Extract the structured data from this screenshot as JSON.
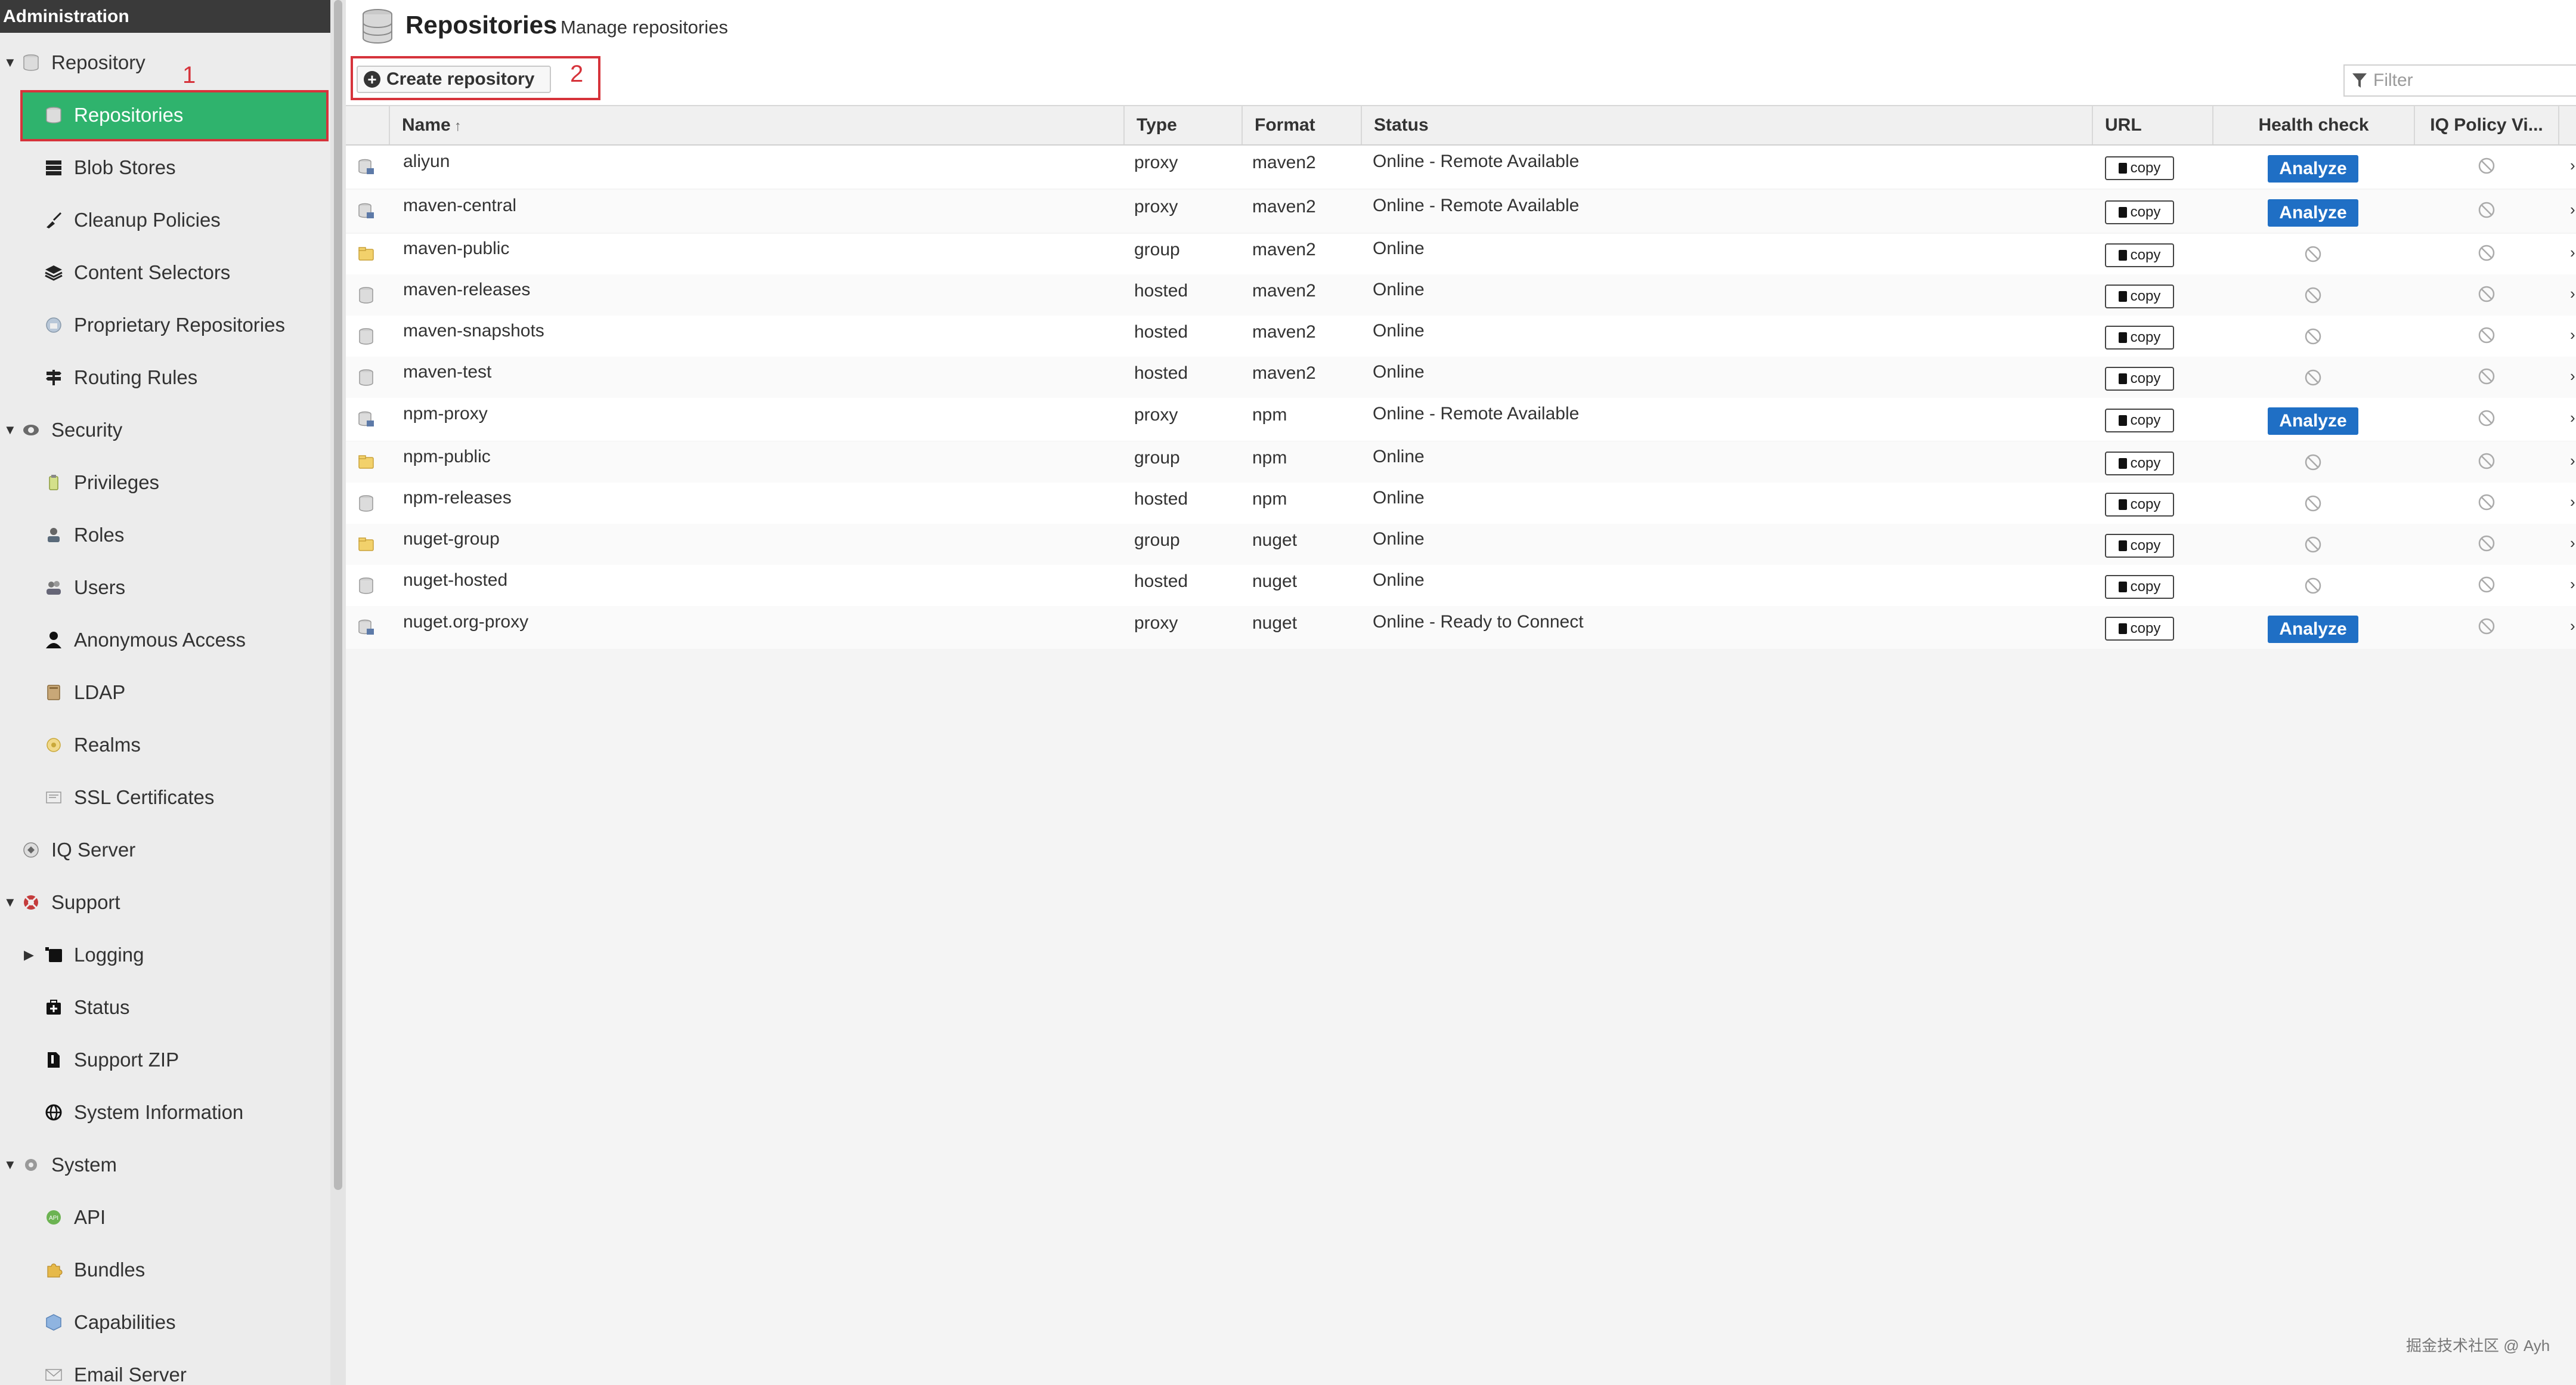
{
  "sidebar": {
    "header": "Administration",
    "items": [
      {
        "label": "Repository",
        "level": 0,
        "expanded": true,
        "icon": "database-icon"
      },
      {
        "label": "Repositories",
        "level": 1,
        "selected": true,
        "icon": "database-icon"
      },
      {
        "label": "Blob Stores",
        "level": 1,
        "icon": "server-icon"
      },
      {
        "label": "Cleanup Policies",
        "level": 1,
        "icon": "broom-icon"
      },
      {
        "label": "Content Selectors",
        "level": 1,
        "icon": "layers-icon"
      },
      {
        "label": "Proprietary Repositories",
        "level": 1,
        "icon": "proprietary-icon"
      },
      {
        "label": "Routing Rules",
        "level": 1,
        "icon": "signpost-icon"
      },
      {
        "label": "Security",
        "level": 0,
        "expanded": true,
        "icon": "security-icon"
      },
      {
        "label": "Privileges",
        "level": 1,
        "icon": "privileges-icon"
      },
      {
        "label": "Roles",
        "level": 1,
        "icon": "role-icon"
      },
      {
        "label": "Users",
        "level": 1,
        "icon": "users-icon"
      },
      {
        "label": "Anonymous Access",
        "level": 1,
        "icon": "user-icon"
      },
      {
        "label": "LDAP",
        "level": 1,
        "icon": "ldap-book-icon"
      },
      {
        "label": "Realms",
        "level": 1,
        "icon": "realm-icon"
      },
      {
        "label": "SSL Certificates",
        "level": 1,
        "icon": "certificate-icon"
      },
      {
        "label": "IQ Server",
        "level": 0,
        "icon": "iq-server-icon"
      },
      {
        "label": "Support",
        "level": 0,
        "expanded": true,
        "icon": "support-icon"
      },
      {
        "label": "Logging",
        "level": 1,
        "collapsed": true,
        "icon": "logging-icon"
      },
      {
        "label": "Status",
        "level": 1,
        "icon": "status-icon"
      },
      {
        "label": "Support ZIP",
        "level": 1,
        "icon": "file-zip-icon"
      },
      {
        "label": "System Information",
        "level": 1,
        "icon": "globe-icon"
      },
      {
        "label": "System",
        "level": 0,
        "expanded": true,
        "icon": "gear-icon"
      },
      {
        "label": "API",
        "level": 1,
        "icon": "api-icon"
      },
      {
        "label": "Bundles",
        "level": 1,
        "icon": "puzzle-icon"
      },
      {
        "label": "Capabilities",
        "level": 1,
        "icon": "cube-icon"
      },
      {
        "label": "Email Server",
        "level": 1,
        "icon": "envelope-icon"
      }
    ],
    "annotation": "1"
  },
  "header": {
    "title": "Repositories",
    "subtitle": "Manage repositories"
  },
  "toolbar": {
    "create_label": "Create repository",
    "annotation": "2",
    "filter_placeholder": "Filter"
  },
  "table": {
    "columns": [
      "Name",
      "Type",
      "Format",
      "Status",
      "URL",
      "Health check",
      "IQ Policy Vi..."
    ],
    "copy_label": "copy",
    "analyze_label": "Analyze",
    "rows": [
      {
        "name": "aliyun",
        "type": "proxy",
        "format": "maven2",
        "status": "Online - Remote Available",
        "analyze": true
      },
      {
        "name": "maven-central",
        "type": "proxy",
        "format": "maven2",
        "status": "Online - Remote Available",
        "analyze": true
      },
      {
        "name": "maven-public",
        "type": "group",
        "format": "maven2",
        "status": "Online",
        "analyze": false
      },
      {
        "name": "maven-releases",
        "type": "hosted",
        "format": "maven2",
        "status": "Online",
        "analyze": false
      },
      {
        "name": "maven-snapshots",
        "type": "hosted",
        "format": "maven2",
        "status": "Online",
        "analyze": false
      },
      {
        "name": "maven-test",
        "type": "hosted",
        "format": "maven2",
        "status": "Online",
        "analyze": false
      },
      {
        "name": "npm-proxy",
        "type": "proxy",
        "format": "npm",
        "status": "Online - Remote Available",
        "analyze": true
      },
      {
        "name": "npm-public",
        "type": "group",
        "format": "npm",
        "status": "Online",
        "analyze": false
      },
      {
        "name": "npm-releases",
        "type": "hosted",
        "format": "npm",
        "status": "Online",
        "analyze": false
      },
      {
        "name": "nuget-group",
        "type": "group",
        "format": "nuget",
        "status": "Online",
        "analyze": false
      },
      {
        "name": "nuget-hosted",
        "type": "hosted",
        "format": "nuget",
        "status": "Online",
        "analyze": false
      },
      {
        "name": "nuget.org-proxy",
        "type": "proxy",
        "format": "nuget",
        "status": "Online - Ready to Connect",
        "analyze": true
      }
    ]
  },
  "watermark": "掘金技术社区 @ Ayh",
  "colors": {
    "selected_bg": "#2fb36d",
    "annotation_red": "#d6333b",
    "analyze_blue": "#1f6fc5",
    "sidebar_bg": "#ececec",
    "header_bg": "#3a3a3a"
  }
}
